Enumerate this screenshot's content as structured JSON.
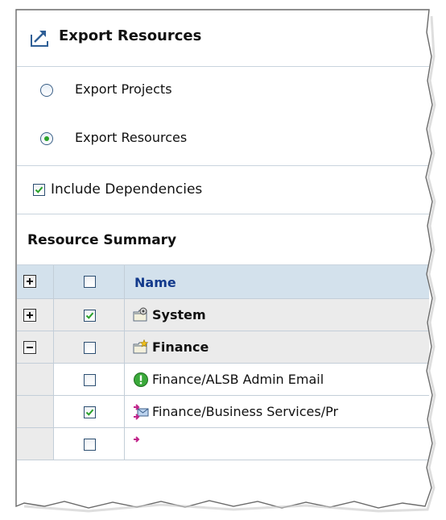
{
  "panel": {
    "title": "Export Resources",
    "icon": "export-arrow-icon"
  },
  "export_options": [
    {
      "label": "Export Projects",
      "selected": false
    },
    {
      "label": "Export Resources",
      "selected": true
    }
  ],
  "include_dependencies": {
    "label": "Include Dependencies",
    "checked": true
  },
  "resource_summary": {
    "title": "Resource Summary",
    "columns": [
      "Name"
    ],
    "rows": [
      {
        "kind": "project",
        "expander": "expand",
        "checked": true,
        "name": "System",
        "icon": "project-folder-gear-icon"
      },
      {
        "kind": "project",
        "expander": "collapse",
        "checked": false,
        "name": "Finance",
        "icon": "project-folder-star-icon"
      },
      {
        "kind": "resource",
        "checked": false,
        "name": "Finance/ALSB Admin Email",
        "icon": "alert-green-icon"
      },
      {
        "kind": "resource",
        "checked": true,
        "name": "Finance/Business Services/Pr",
        "icon": "business-service-icon"
      }
    ]
  },
  "colors": {
    "header_row_bg": "#d3e1ec",
    "group_row_bg": "#ebebeb",
    "name_header_text": "#133a8c",
    "radio_selected_dot": "#2aa22a",
    "check_mark": "#2aa22a"
  }
}
